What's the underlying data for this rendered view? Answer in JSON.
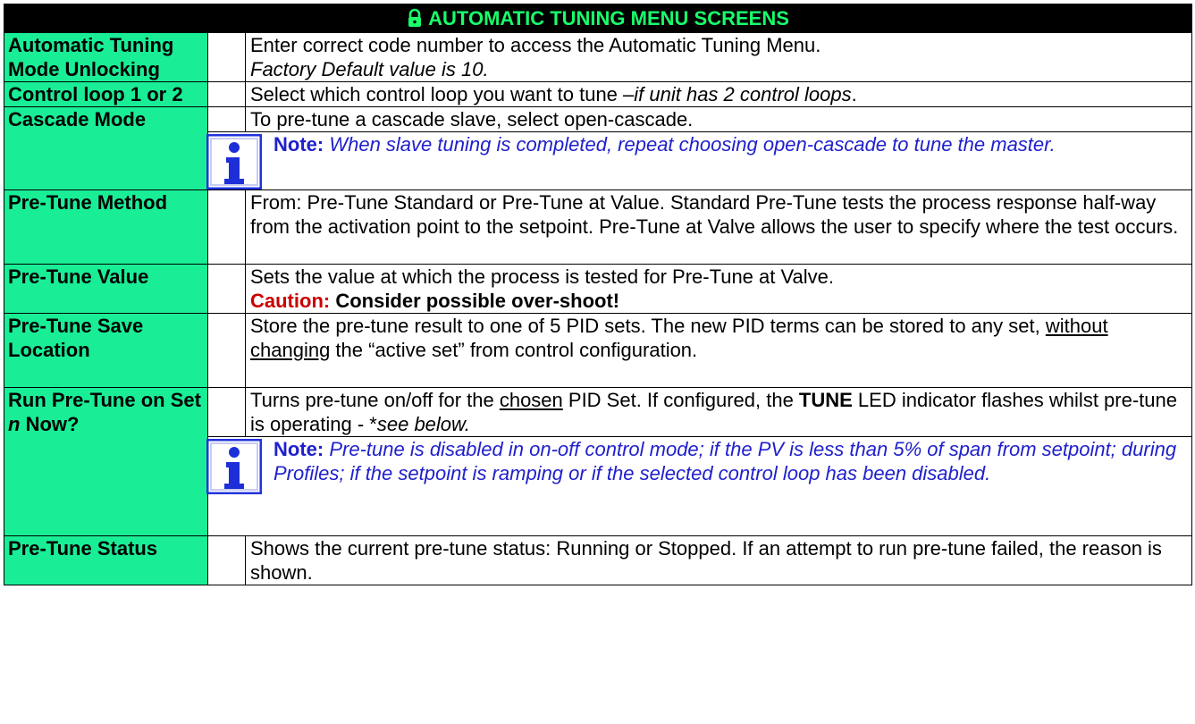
{
  "header": {
    "title": "AUTOMATIC TUNING MENU SCREENS",
    "icon": "lock-icon"
  },
  "rows": {
    "unlock": {
      "label": "Automatic Tuning Mode Unlocking",
      "text": "Enter correct code number to access the Automatic Tuning Menu.",
      "italic": "Factory Default value is 10."
    },
    "loop": {
      "label": "Control loop 1 or 2",
      "text": "Select which control loop you want to tune –",
      "italic": "if unit has 2 control loops",
      "end": "."
    },
    "cascade": {
      "label": "Cascade Mode",
      "text": "To pre-tune a cascade slave, select open-cascade.",
      "note_kw": "Note:",
      "note": " When slave tuning is completed, repeat choosing open-cascade to tune the master."
    },
    "method": {
      "label": "Pre-Tune Method",
      "text": "From: Pre-Tune Standard or Pre-Tune at Value. Standard Pre-Tune tests the process response half-way from the activation point to the setpoint. Pre-Tune at Valve allows the user to specify where the test occurs."
    },
    "value": {
      "label": "Pre-Tune Value",
      "text": "Sets the value at which the process is tested for Pre-Tune at Valve.",
      "caution_kw": "Caution:",
      "caution": " Consider possible over-shoot!"
    },
    "save": {
      "label": "Pre-Tune Save Location",
      "text1": "Store the pre-tune result to one of 5 PID sets. The new PID terms can be stored to any set, ",
      "underline": "without changing",
      "text2": " the “active set” from control configuration."
    },
    "run": {
      "label1": "Run Pre-Tune on Set ",
      "label_n": "n",
      "label2": " Now?",
      "text1": "Turns pre-tune on/off for the ",
      "underline": "chosen",
      "text2": " PID Set. If configured, the ",
      "bold": "TUNE",
      "text3": " LED indicator flashes whilst pre-tune is operating - *",
      "italic": "see below.",
      "note_kw": "Note:",
      "note": " Pre-tune is disabled in on-off control mode; if the PV is less than 5% of span from setpoint; during Profiles; if the setpoint is ramping or if the selected control loop has been disabled."
    },
    "status": {
      "label": "Pre-Tune Status",
      "text": "Shows the current pre-tune status: Running or Stopped. If an attempt to run pre-tune failed, the reason is shown."
    }
  },
  "colors": {
    "label_bg": "#19ee96",
    "header_bg": "#000000",
    "header_fg": "#19ff6b",
    "note": "#2020cc",
    "caution": "#cc0000"
  }
}
